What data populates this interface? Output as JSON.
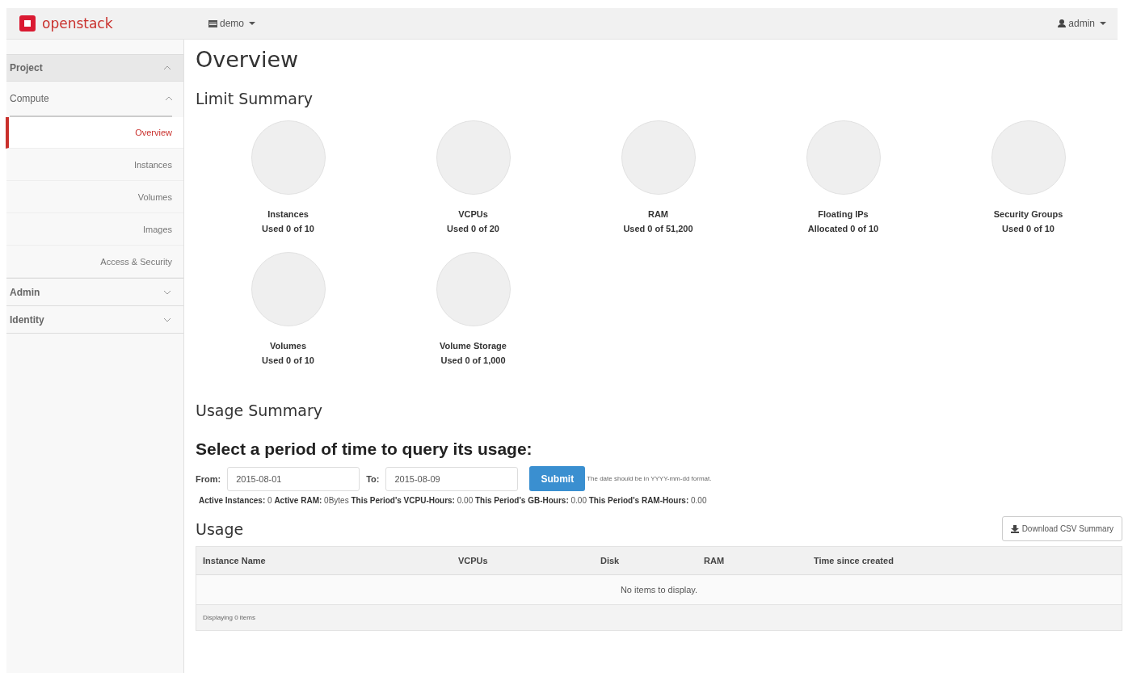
{
  "header": {
    "brand": "openstack",
    "project": "demo",
    "user": "admin"
  },
  "sidebar": {
    "items": [
      {
        "kind": "group",
        "label": "Project",
        "expanded": true,
        "children": [
          {
            "kind": "subgroup",
            "label": "Compute",
            "expanded": true,
            "children": [
              {
                "kind": "link",
                "label": "Overview",
                "selected": true
              },
              {
                "kind": "link",
                "label": "Instances",
                "selected": false
              },
              {
                "kind": "link",
                "label": "Volumes",
                "selected": false
              },
              {
                "kind": "link",
                "label": "Images",
                "selected": false
              },
              {
                "kind": "link",
                "label": "Access & Security",
                "selected": false
              }
            ]
          }
        ]
      },
      {
        "kind": "group",
        "label": "Admin",
        "expanded": false
      },
      {
        "kind": "group",
        "label": "Identity",
        "expanded": false
      }
    ]
  },
  "page_title": "Overview",
  "limit_summary": {
    "title": "Limit Summary",
    "limits": [
      {
        "label": "Instances",
        "usage": "Used 0 of 10"
      },
      {
        "label": "VCPUs",
        "usage": "Used 0 of 20"
      },
      {
        "label": "RAM",
        "usage": "Used 0 of 51,200"
      },
      {
        "label": "Floating IPs",
        "usage": "Allocated 0 of 10"
      },
      {
        "label": "Security Groups",
        "usage": "Used 0 of 10"
      },
      {
        "label": "Volumes",
        "usage": "Used 0 of 10"
      },
      {
        "label": "Volume Storage",
        "usage": "Used 0 of 1,000"
      }
    ]
  },
  "usage_summary": {
    "title": "Usage Summary",
    "query_title": "Select a period of time to query its usage:",
    "from": {
      "label": "From:",
      "value": "2015-08-01"
    },
    "to": {
      "label": "To:",
      "value": "2015-08-09"
    },
    "submit": "Submit",
    "hint": "The date should be in YYYY-mm-dd format.",
    "stats": "**Active Instances:** 0 **Active RAM:** 0Bytes **This Period's VCPU-Hours:** 0.00 **This Period's GB-Hours:** 0.00 **This Period's RAM-Hours:** 0.00"
  },
  "usage": {
    "title": "Usage",
    "download": "Download CSV Summary",
    "table": {
      "columns": [
        "Instance Name",
        "VCPUs",
        "Disk",
        "RAM",
        "Time since created"
      ],
      "empty": "No items to display.",
      "footer": "Displaying 0 items"
    }
  }
}
